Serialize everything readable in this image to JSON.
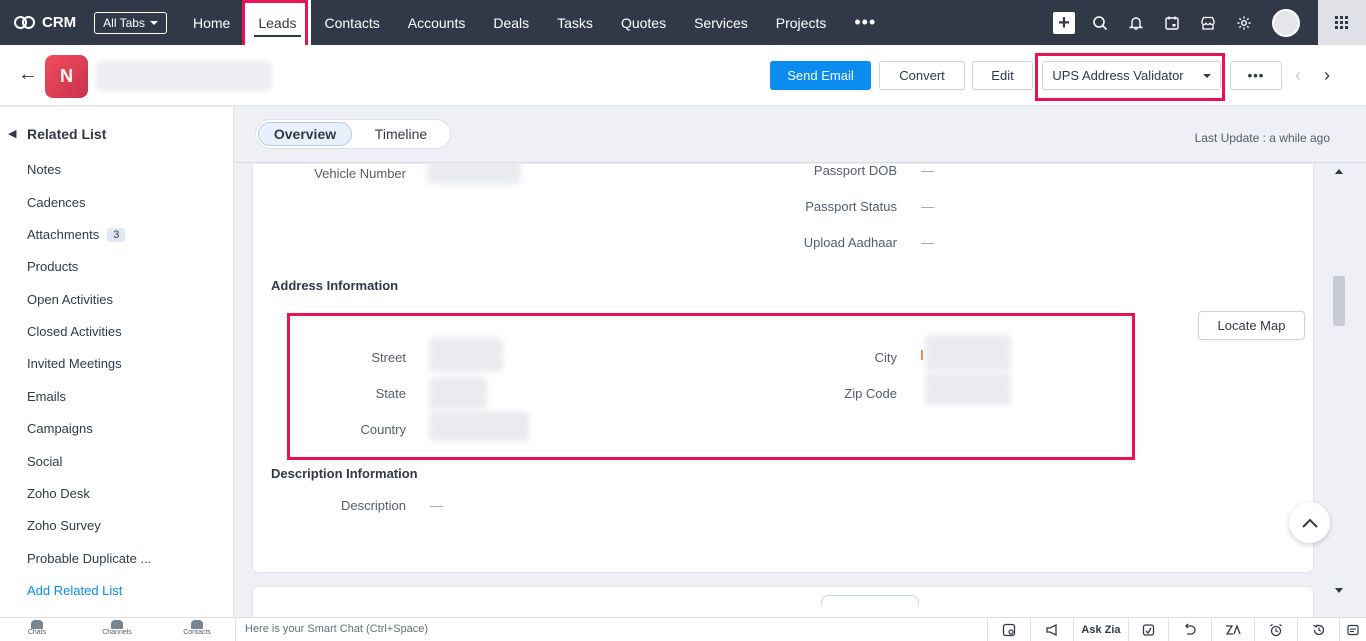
{
  "nav": {
    "brand": "CRM",
    "all_tabs": "All Tabs",
    "tabs": [
      "Home",
      "Leads",
      "Contacts",
      "Accounts",
      "Deals",
      "Tasks",
      "Quotes",
      "Services",
      "Projects"
    ],
    "more": "•••",
    "active_tab": "Leads"
  },
  "record": {
    "avatar_letter": "N",
    "buttons": {
      "send_email": "Send Email",
      "convert": "Convert",
      "edit": "Edit",
      "ups": "UPS Address Validator",
      "more": "•••"
    }
  },
  "sidebar": {
    "title": "Related List",
    "items": [
      "Notes",
      "Cadences",
      "Attachments",
      "Products",
      "Open Activities",
      "Closed Activities",
      "Invited Meetings",
      "Emails",
      "Campaigns",
      "Social",
      "Zoho Desk",
      "Zoho Survey",
      "Probable Duplicate ..."
    ],
    "attachments_count": "3",
    "add": "Add Related List"
  },
  "tabs": {
    "overview": "Overview",
    "timeline": "Timeline",
    "last_update": "Last Update : a while ago"
  },
  "fields": {
    "vehicle_number": "Vehicle Number",
    "passport_dob": "Passport DOB",
    "passport_status": "Passport Status",
    "upload_aadhaar": "Upload Aadhaar",
    "dash": "—"
  },
  "address": {
    "title": "Address Information",
    "street": "Street",
    "state": "State",
    "country": "Country",
    "city": "City",
    "zip": "Zip Code",
    "locate_map": "Locate Map"
  },
  "description": {
    "title": "Description Information",
    "label": "Description",
    "value": "—"
  },
  "bottombar": {
    "chats": "Chats",
    "channels": "Channels",
    "contacts": "Contacts",
    "smart_chat": "Here is your Smart Chat (Ctrl+Space)",
    "ask_zia": "Ask Zia"
  },
  "colors": {
    "nav_bg": "#313949",
    "primary": "#0b8cf1",
    "highlight": "#eb1253"
  }
}
